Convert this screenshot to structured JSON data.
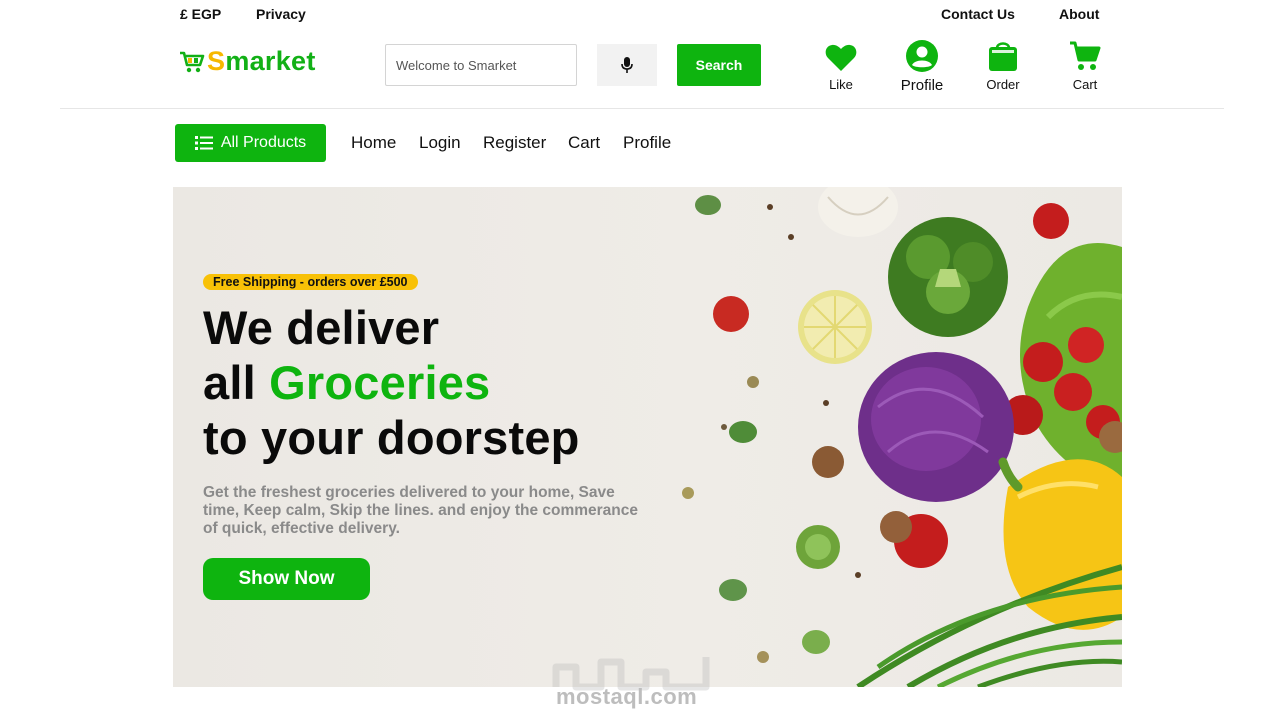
{
  "topbar": {
    "currency": "£ EGP",
    "privacy": "Privacy",
    "contact": "Contact Us",
    "about": "About"
  },
  "header": {
    "brand_first": "S",
    "brand_rest": "market",
    "search_placeholder": "Welcome to Smarket",
    "search_label": "Search",
    "icons": {
      "like": "Like",
      "profile": "Profile",
      "order": "Order",
      "cart": "Cart"
    }
  },
  "nav": {
    "all_products": "All Products",
    "links": [
      "Home",
      "Login",
      "Register",
      "Cart",
      "Profile"
    ]
  },
  "hero": {
    "badge": "Free Shipping - orders over £500",
    "line1": "We deliver",
    "line2_prefix": "all ",
    "line2_highlight": "Groceries",
    "line3": "to your doorstep",
    "description": "Get the freshest groceries delivered to your home, Save time, Keep calm, Skip the lines. and enjoy the commerance of quick, effective delivery.",
    "cta": "Show Now"
  },
  "watermark": {
    "text": "mostaql.com"
  },
  "colors": {
    "accent": "#0eb40f",
    "badge": "#f8c107",
    "logo_s": "#f6b800"
  }
}
